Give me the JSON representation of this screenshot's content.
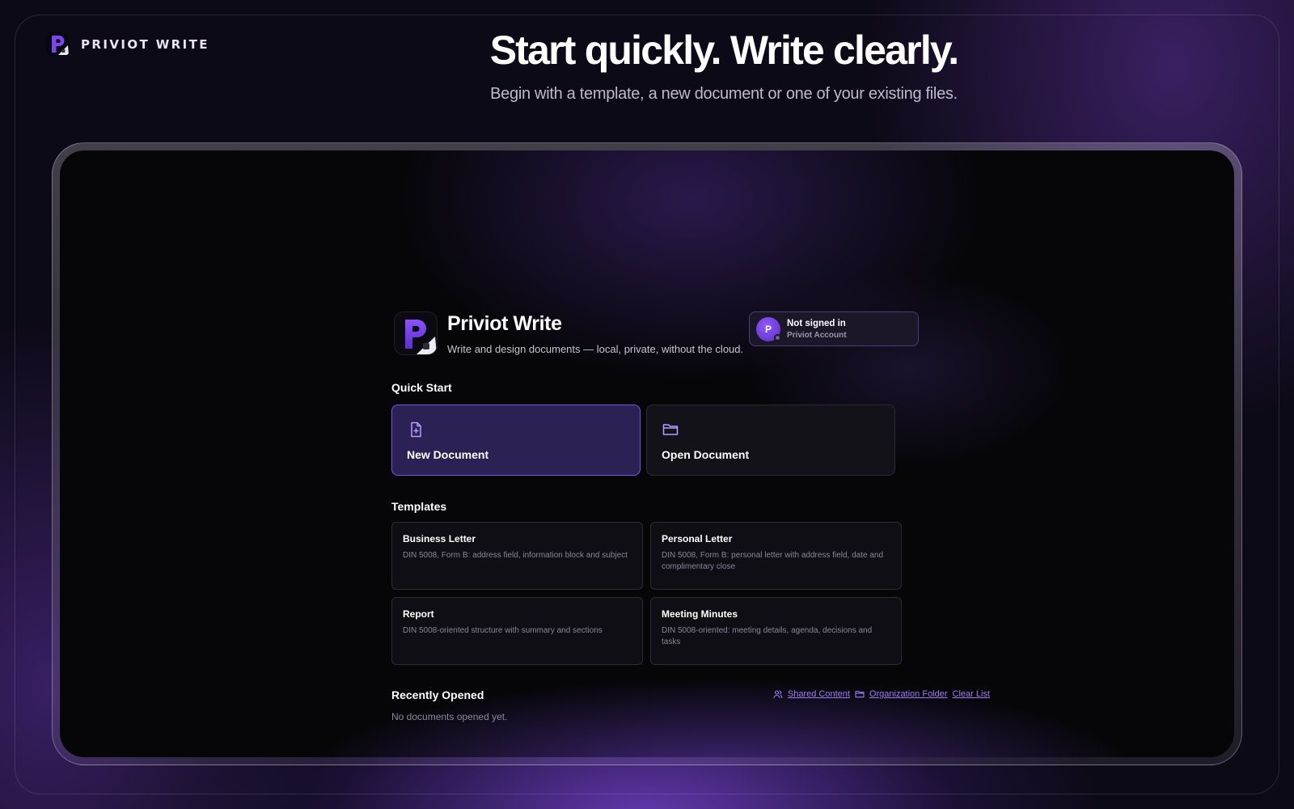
{
  "brand": {
    "name": "PRIVIOT WRITE",
    "logo_icon": "priviot-logo-icon"
  },
  "hero": {
    "title": "Start quickly. Write clearly.",
    "subtitle": "Begin with a template, a new document or one of your existing files."
  },
  "app": {
    "title": "Priviot Write",
    "tagline": "Write and design documents — local, private, without the cloud.",
    "account": {
      "avatar_initial": "P",
      "status": "Not signed in",
      "label": "Priviot Account"
    },
    "quick_start": {
      "heading": "Quick Start",
      "actions": [
        {
          "label": "New Document",
          "icon": "new-document-icon",
          "selected": true
        },
        {
          "label": "Open Document",
          "icon": "folder-icon",
          "selected": false
        }
      ]
    },
    "templates": {
      "heading": "Templates",
      "items": [
        {
          "title": "Business Letter",
          "description": "DIN 5008, Form B: address field, information block and subject"
        },
        {
          "title": "Personal Letter",
          "description": "DIN 5008, Form B: personal letter with address field, date and complimentary close"
        },
        {
          "title": "Report",
          "description": "DIN 5008-oriented structure with summary and sections"
        },
        {
          "title": "Meeting Minutes",
          "description": "DIN 5008-oriented: meeting details, agenda, decisions and tasks"
        }
      ]
    },
    "recent": {
      "heading": "Recently Opened",
      "empty_text": "No documents opened yet.",
      "links": {
        "shared": "Shared Content",
        "organization": "Organization Folder",
        "clear": "Clear List"
      }
    }
  },
  "colors": {
    "accent": "#7a55e6",
    "link": "#9f7cf5",
    "background": "#0d0a17"
  }
}
